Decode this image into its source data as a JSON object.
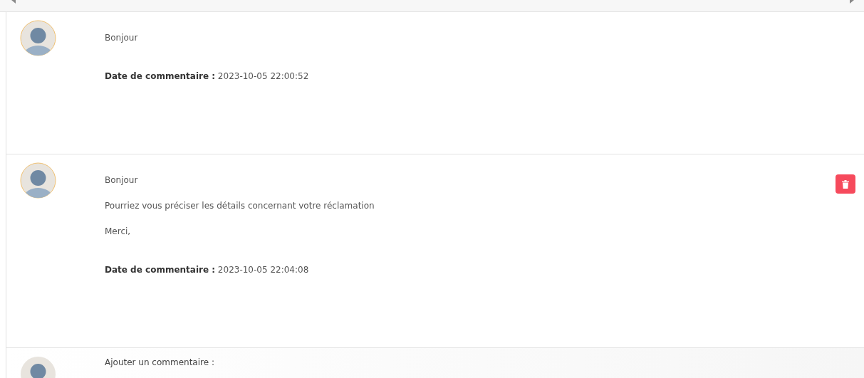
{
  "comments": [
    {
      "lines": [
        "Bonjour"
      ],
      "date": "**Date de commentaire :** 2023-10-05 22:00:52",
      "deletable": false
    },
    {
      "lines": [
        "Bonjour",
        "Pourriez vous préciser les détails concernant votre réclamation",
        "Merci,"
      ],
      "date": "**Date de commentaire :** 2023-10-05 22:04:08",
      "deletable": true
    }
  ],
  "add_comment": {
    "label": "Ajouter un commentaire :"
  }
}
